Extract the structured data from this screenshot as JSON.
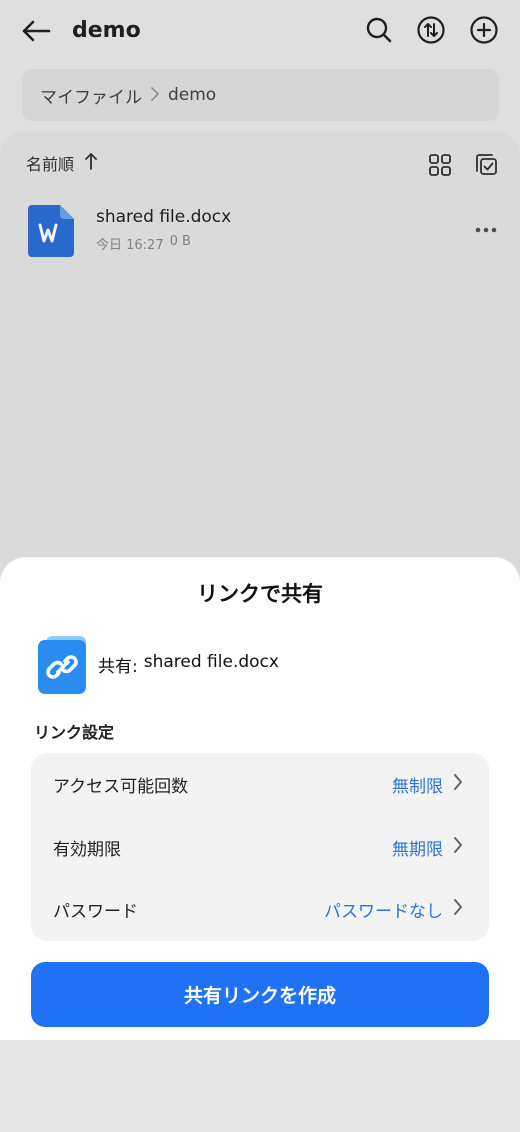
{
  "header": {
    "title": "demo"
  },
  "breadcrumb": {
    "root": "マイファイル",
    "current": "demo"
  },
  "list": {
    "sort_label": "名前順",
    "files": [
      {
        "name": "shared file.docx",
        "date": "今日 16:27",
        "size": "0 B"
      }
    ]
  },
  "sheet": {
    "title": "リンクで共有",
    "share_prefix": "共有:",
    "share_file": "shared file.docx",
    "section_label": "リンク設定",
    "settings": [
      {
        "label": "アクセス可能回数",
        "value": "無制限"
      },
      {
        "label": "有効期限",
        "value": "無期限"
      },
      {
        "label": "パスワード",
        "value": "パスワードなし"
      }
    ],
    "create_button": "共有リンクを作成"
  },
  "colors": {
    "accent": "#1f72f5",
    "value_text": "#2f74d0",
    "word_blue": "#2b6fd6"
  },
  "icons": [
    "back-arrow-icon",
    "search-icon",
    "sort-toggle-icon",
    "add-icon",
    "chevron-right-icon",
    "sort-up-arrow-icon",
    "grid-view-icon",
    "multi-select-icon",
    "word-document-icon",
    "more-icon",
    "link-icon"
  ]
}
